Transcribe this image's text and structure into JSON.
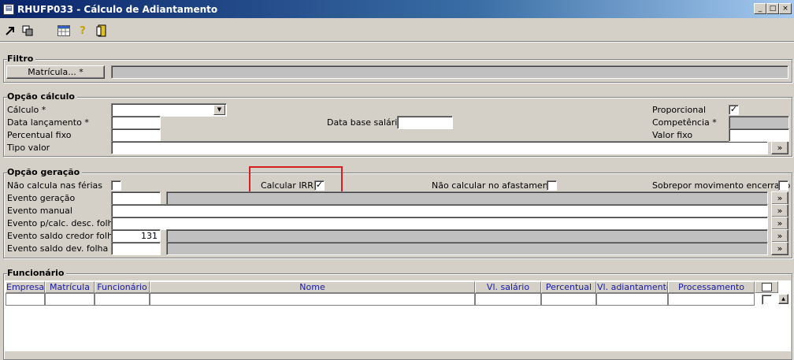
{
  "window": {
    "title": "RHUFP033 - Cálculo de Adiantamento"
  },
  "window_buttons": {
    "minimize": "_",
    "maximize": "□",
    "close": "×"
  },
  "toolbar": {
    "icons": [
      "export-icon",
      "copy-icon",
      "calendar-grid-icon",
      "help-icon",
      "exit-door-icon"
    ]
  },
  "filtro": {
    "title": "Filtro",
    "matricula_button": "Matrícula... *",
    "matricula_value": ""
  },
  "opcao_calculo": {
    "title": "Opção cálculo",
    "calculo_label": "Cálculo *",
    "calculo_value": "",
    "data_lancamento_label": "Data lançamento *",
    "data_lancamento_value": "",
    "percentual_fixo_label": "Percentual fixo",
    "percentual_fixo_value": "",
    "tipo_valor_label": "Tipo valor",
    "tipo_valor_value": "",
    "tipo_valor_button": "»",
    "data_base_salario_label": "Data base salário",
    "data_base_salario_value": "",
    "proporcional_label": "Proporcional",
    "proporcional_checked": "✓",
    "competencia_label": "Competência *",
    "competencia_value": "",
    "valor_fixo_label": "Valor fixo",
    "valor_fixo_value": ""
  },
  "opcao_geracao": {
    "title": "Opção geração",
    "nao_calcula_ferias_label": "Não calcula nas férias",
    "nao_calcula_ferias_checked": "",
    "calcular_irrf_label": "Calcular IRRF",
    "calcular_irrf_checked": "✓",
    "nao_calcular_afastamento_label": "Não calcular no afastamento",
    "nao_calcular_afastamento_checked": "",
    "sobrepor_label": "Sobrepor movimento encerrado",
    "sobrepor_checked": "",
    "evento_geracao_label": "Evento geração",
    "evento_geracao_code": "",
    "evento_manual_label": "Evento manual",
    "evento_calc_desc_label": "Evento p/calc. desc. folha",
    "evento_saldo_credor_label": "Evento saldo credor folha",
    "evento_saldo_credor_code": "131",
    "evento_saldo_dev_label": "Evento saldo dev. folha",
    "evento_saldo_dev_code": "",
    "lookup_button": "»"
  },
  "funcionario": {
    "title": "Funcionário",
    "columns": [
      "Empresa",
      "Matrícula",
      "Funcionário",
      "Nome",
      "Vl. salário",
      "Percentual",
      "Vl. adiantamento",
      "Processamento"
    ],
    "scroll_up": "▲"
  },
  "colors": {
    "title_start": "#0a246a",
    "title_end": "#a6caf0",
    "highlight": "#d42020",
    "header_text": "#1a1aa6"
  }
}
